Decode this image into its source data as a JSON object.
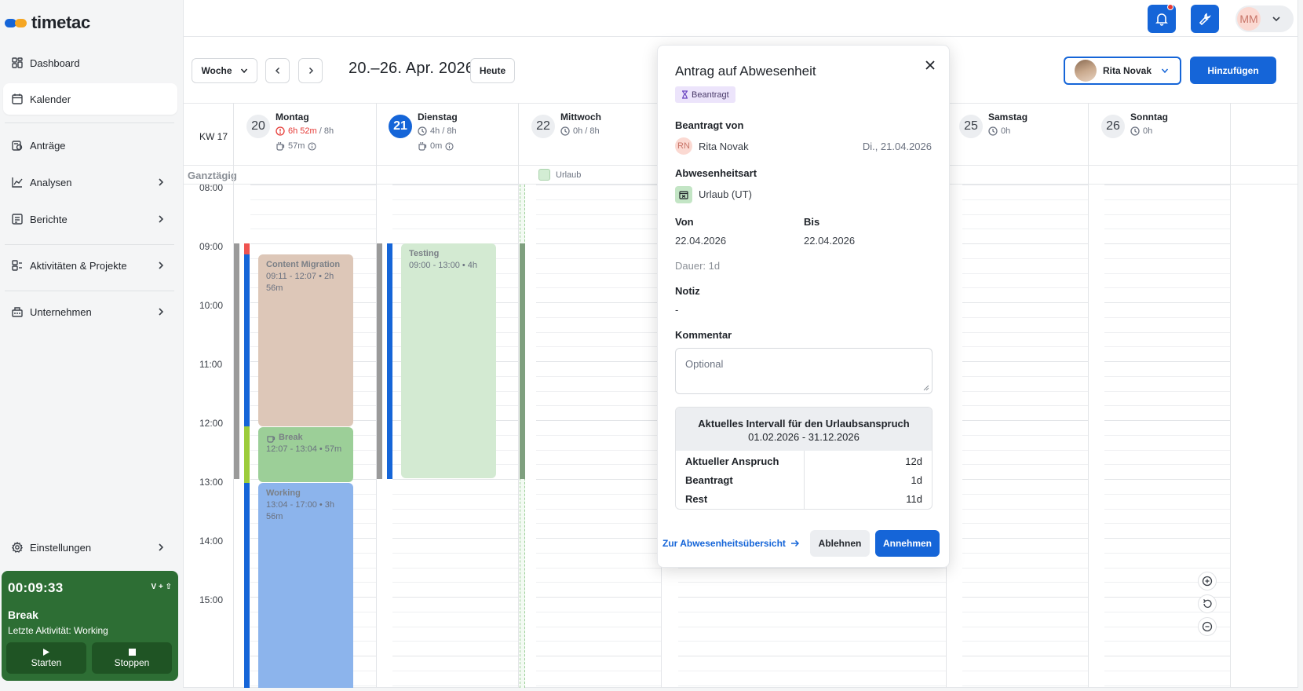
{
  "app": {
    "logo_text": "timetac"
  },
  "sidebar": {
    "items": [
      {
        "label": "Dashboard",
        "icon": "grid-icon"
      },
      {
        "label": "Kalender",
        "icon": "calendar-icon"
      },
      {
        "label": "Anträge",
        "icon": "requests-icon"
      },
      {
        "label": "Analysen",
        "icon": "chart-icon"
      },
      {
        "label": "Berichte",
        "icon": "report-icon"
      },
      {
        "label": "Aktivitäten & Projekte",
        "icon": "activities-icon"
      },
      {
        "label": "Unternehmen",
        "icon": "building-icon"
      },
      {
        "label": "Einstellungen",
        "icon": "gear-icon"
      }
    ]
  },
  "timer": {
    "time": "00:09:33",
    "shortcut": "V + ⇧",
    "title": "Break",
    "last_activity": "Letzte Aktivität: Working",
    "start_label": "Starten",
    "stop_label": "Stoppen"
  },
  "topbar": {
    "user_initials": "MM"
  },
  "toolbar": {
    "view_label": "Woche",
    "range": "20.–26. Apr. 2026",
    "today_label": "Heute",
    "user_name": "Rita Novak",
    "add_label": "Hinzufügen"
  },
  "calendar": {
    "week_label": "KW 17",
    "allday_label": "Ganztägig",
    "allday_event": "Urlaub",
    "hours": [
      "08:00",
      "09:00",
      "10:00",
      "11:00",
      "12:00",
      "13:00",
      "14:00",
      "15:00"
    ],
    "days": [
      {
        "num": "20",
        "name": "Montag",
        "worked": "6h 52m",
        "target": " / 8h",
        "break": "57m"
      },
      {
        "num": "21",
        "name": "Dienstag",
        "worked": "4h / 8h",
        "break": "0m"
      },
      {
        "num": "22",
        "name": "Mittwoch",
        "worked": "0h / 8h"
      },
      {
        "num": "25",
        "name": "Samstag",
        "worked": "0h"
      },
      {
        "num": "26",
        "name": "Sonntag",
        "worked": "0h"
      }
    ],
    "events": {
      "content_migration": {
        "title": "Content Migration",
        "time": "09:11 - 12:07 • 2h 56m"
      },
      "break": {
        "title": "Break",
        "time": "12:07 - 13:04 • 57m"
      },
      "working": {
        "title": "Working",
        "time": "13:04 - 17:00 • 3h 56m"
      },
      "testing": {
        "title": "Testing",
        "time": "09:00 - 13:00 • 4h"
      }
    }
  },
  "modal": {
    "title": "Antrag auf Abwesenheit",
    "status": "Beantragt",
    "requested_by_label": "Beantragt von",
    "requester_initials": "RN",
    "requester_name": "Rita Novak",
    "requested_date": "Di., 21.04.2026",
    "type_label": "Abwesenheitsart",
    "type_value": "Urlaub (UT)",
    "from_label": "Von",
    "from_value": "22.04.2026",
    "to_label": "Bis",
    "to_value": "22.04.2026",
    "duration": "Dauer: 1d",
    "note_label": "Notiz",
    "note_value": "-",
    "comment_label": "Kommentar",
    "comment_placeholder": "Optional",
    "quota_title": "Aktuelles Intervall für den Urlaubsanspruch",
    "quota_range": "01.02.2026 - 31.12.2026",
    "quota_rows": [
      {
        "k": "Aktueller Anspruch",
        "v": "12d"
      },
      {
        "k": "Beantragt",
        "v": "1d"
      },
      {
        "k": "Rest",
        "v": "11d"
      }
    ],
    "overview_link": "Zur Abwesenheitsübersicht",
    "reject_label": "Ablehnen",
    "accept_label": "Annehmen"
  },
  "colors": {
    "accent": "#1565d8",
    "timer_bg": "#2d6e34",
    "event_migration": "#ddc7b8",
    "event_break": "#9ccf98",
    "event_working": "#8cb4ec",
    "event_testing": "#d3ead2"
  }
}
